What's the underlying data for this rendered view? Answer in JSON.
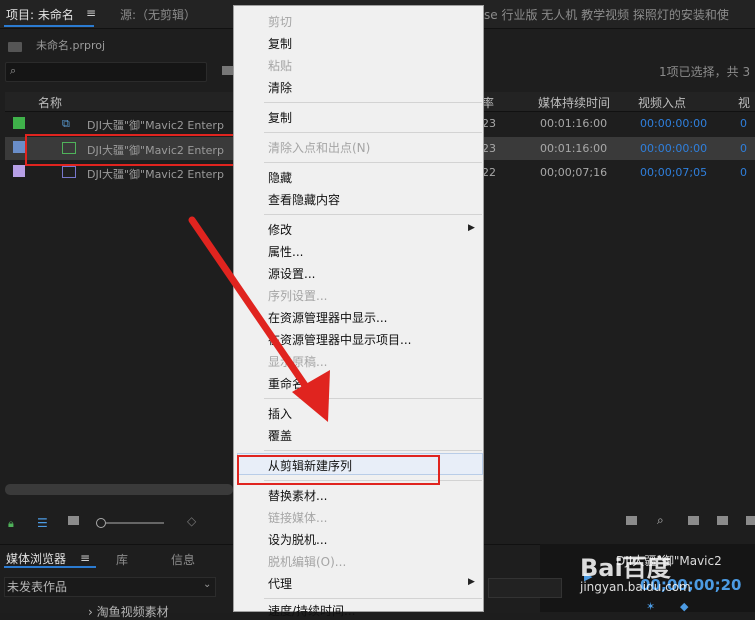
{
  "header": {
    "project_tab": "项目: 未命名",
    "source_tab": "源:（无剪辑）",
    "source_right_text": "se 行业版 无人机 教学视频 探照灯的安装和使"
  },
  "project": {
    "file_name": "未命名.prproj",
    "selection_info": "1项已选择，共 3",
    "columns": {
      "name": "名称",
      "rate": "率",
      "duration": "媒体持续时间",
      "video_in": "视频入点",
      "video_out": "视"
    },
    "rows": [
      {
        "swatch": "#3fb14a",
        "name": "DJI大疆\"御\"Mavic2 Enterp",
        "rate": "23",
        "duration": "00:01:16:00",
        "video_in": "00:00:00:00",
        "video_out": "0"
      },
      {
        "swatch": "#6a8ec9",
        "name": "DJI大疆\"御\"Mavic2 Enterp",
        "rate": "23",
        "duration": "00:01:16:00",
        "video_in": "00:00:00:00",
        "video_out": "0"
      },
      {
        "swatch": "#b7a0e6",
        "name": "DJI大疆\"御\"Mavic2 Enterp",
        "rate": "22",
        "duration": "00;00;07;16",
        "video_in": "00;00;07;05",
        "video_out": "0"
      }
    ]
  },
  "context_menu": {
    "items": [
      {
        "label": "剪切",
        "disabled": true
      },
      {
        "label": "复制",
        "disabled": false
      },
      {
        "label": "粘贴",
        "disabled": true
      },
      {
        "label": "清除",
        "disabled": false
      },
      {
        "label": "复制",
        "disabled": false
      },
      {
        "label": "清除入点和出点(N)",
        "disabled": true
      },
      {
        "label": "隐藏",
        "disabled": false
      },
      {
        "label": "查看隐藏内容",
        "disabled": false
      },
      {
        "label": "修改",
        "disabled": false,
        "submenu": true
      },
      {
        "label": "属性...",
        "disabled": false
      },
      {
        "label": "源设置...",
        "disabled": false
      },
      {
        "label": "序列设置...",
        "disabled": true
      },
      {
        "label": "在资源管理器中显示...",
        "disabled": false
      },
      {
        "label": "在资源管理器中显示项目...",
        "disabled": false
      },
      {
        "label": "显示原稿...",
        "disabled": true
      },
      {
        "label": "重命名",
        "disabled": false
      },
      {
        "label": "插入",
        "disabled": false
      },
      {
        "label": "覆盖",
        "disabled": false
      },
      {
        "label": "从剪辑新建序列",
        "disabled": false,
        "highlighted": true
      },
      {
        "label": "替换素材...",
        "disabled": false
      },
      {
        "label": "链接媒体...",
        "disabled": true
      },
      {
        "label": "设为脱机...",
        "disabled": false
      },
      {
        "label": "脱机编辑(O)...",
        "disabled": true
      },
      {
        "label": "代理",
        "disabled": false,
        "submenu": true
      },
      {
        "label": "速度/持续时间...",
        "disabled": false
      }
    ]
  },
  "media_browser": {
    "tab": "媒体浏览器",
    "library_tab": "库",
    "info_tab": "信息",
    "dropdown_value": "未发表作品",
    "tree_item": "› 淘鱼视频素材"
  },
  "program": {
    "name": "DJI大疆\"御\"Mavic2",
    "timecode": "00;00;00;20"
  },
  "watermark": {
    "logo": "Bai百度",
    "url": "jingyan.baidu.com"
  },
  "colors": {
    "accent": "#2b7bd1",
    "annotation_red": "#e0241f",
    "timecode_blue": "#2f7fdc"
  },
  "icons": [
    "hamburger-icon",
    "search-icon",
    "folder-icon",
    "sequence-icon",
    "film-icon",
    "chevron-right-icon"
  ]
}
